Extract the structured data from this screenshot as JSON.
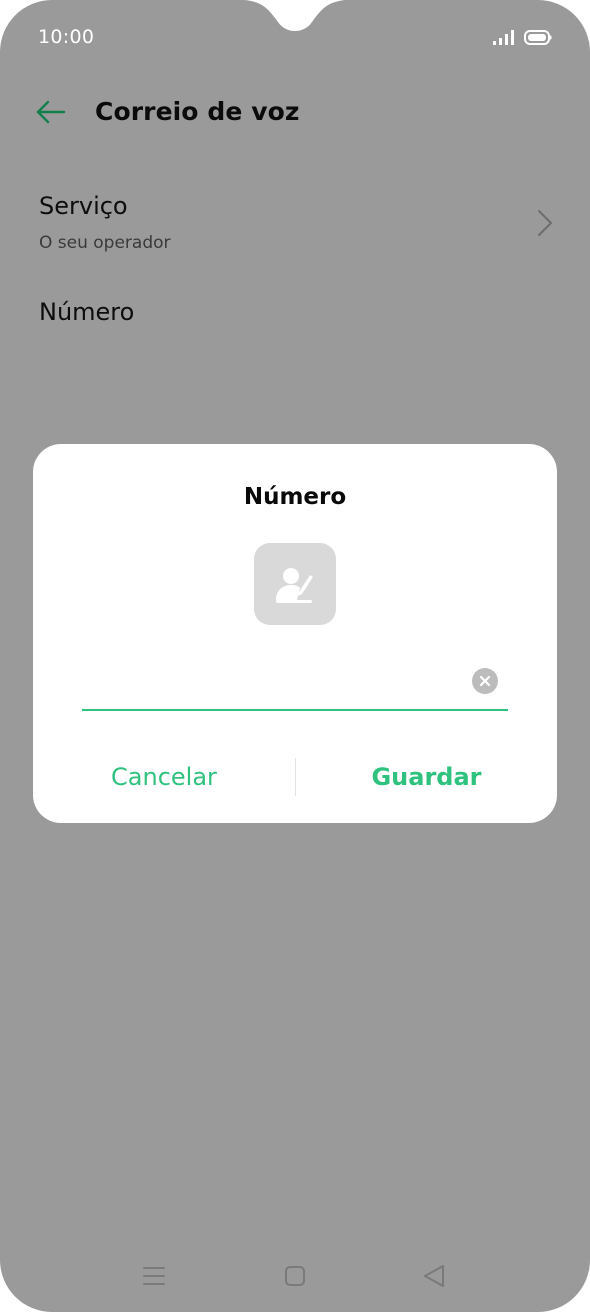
{
  "status_bar": {
    "time": "10:00",
    "signal_icon": "signal-bars-icon",
    "battery_icon": "battery-icon"
  },
  "header": {
    "back_icon": "arrow-left-icon",
    "title": "Correio de voz"
  },
  "settings": {
    "service": {
      "title": "Serviço",
      "subtitle": "O seu operador",
      "chevron_icon": "chevron-right-icon"
    },
    "number": {
      "title": "Número"
    }
  },
  "dialog": {
    "title": "Número",
    "contact_icon": "contact-edit-icon",
    "input": {
      "value": "",
      "placeholder": ""
    },
    "clear_icon": "clear-icon",
    "cancel_label": "Cancelar",
    "save_label": "Guardar"
  },
  "colors": {
    "accent": "#2fc27f",
    "scrim_background": "#9a9a9a",
    "dialog_background": "#ffffff"
  },
  "navbar": {
    "menu_icon": "menu-icon",
    "home_icon": "home-icon",
    "back_icon": "back-triangle-icon"
  }
}
